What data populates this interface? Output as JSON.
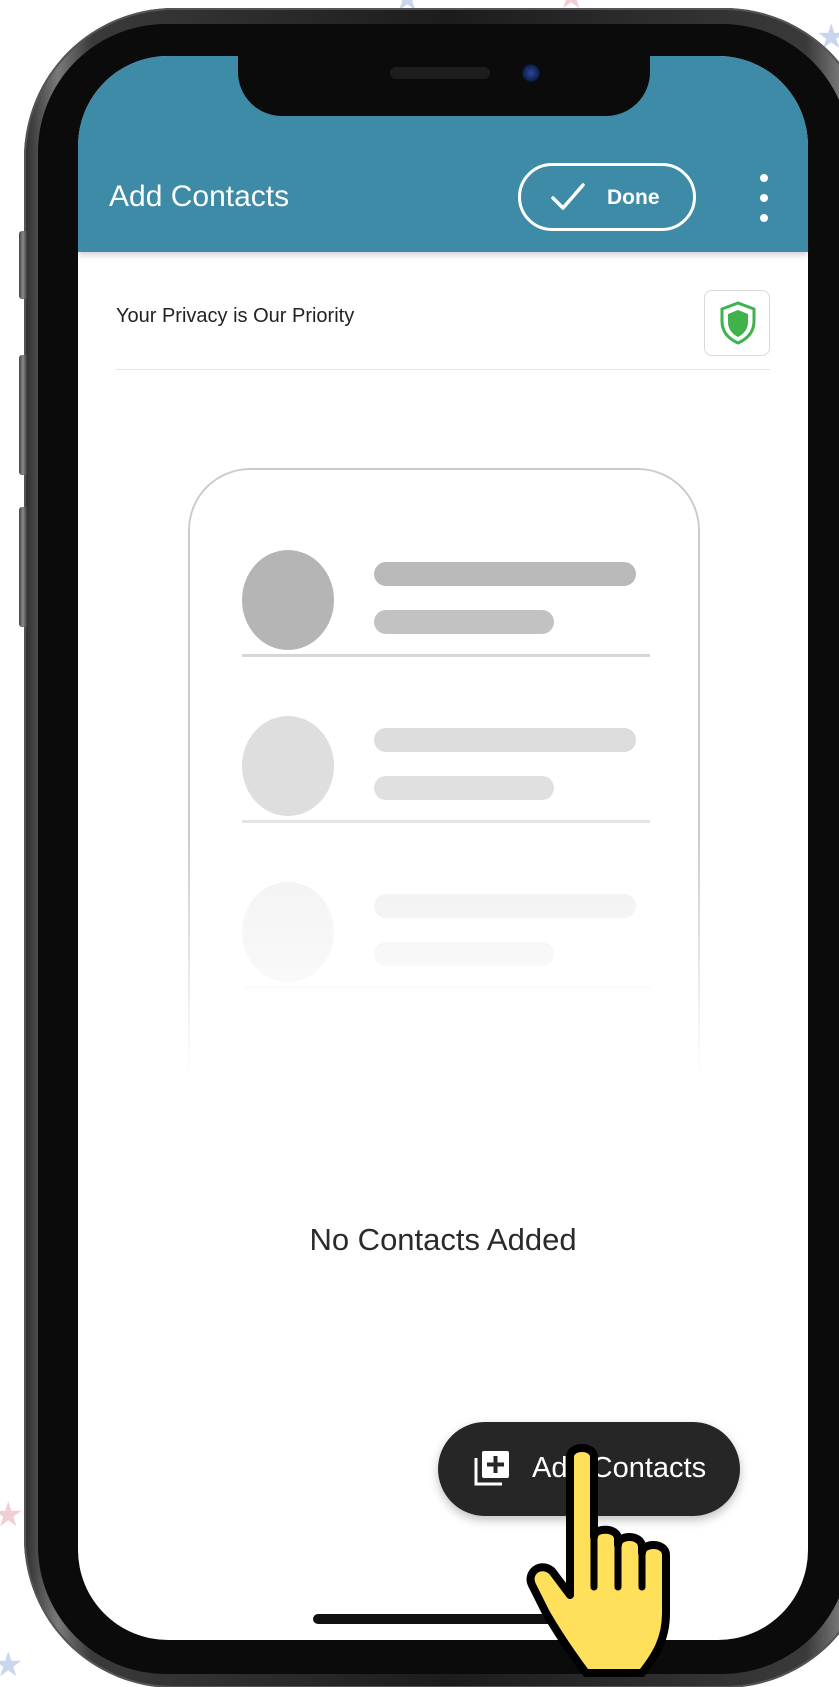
{
  "app_bar": {
    "title": "Add Contacts",
    "done_label": "Done",
    "menu_icon": "more-vert-icon",
    "color": "#3d8ba7"
  },
  "privacy": {
    "text": "Your Privacy is Our Priority",
    "icon": "shield-icon",
    "icon_color": "#3fb24c"
  },
  "empty_state": {
    "message": "No Contacts Added"
  },
  "fab": {
    "label": "Add Contacts",
    "icon": "add-to-library-icon",
    "color": "#262626"
  },
  "overlay": {
    "icon": "hand-pointer-icon",
    "color": "#ffe05a"
  }
}
